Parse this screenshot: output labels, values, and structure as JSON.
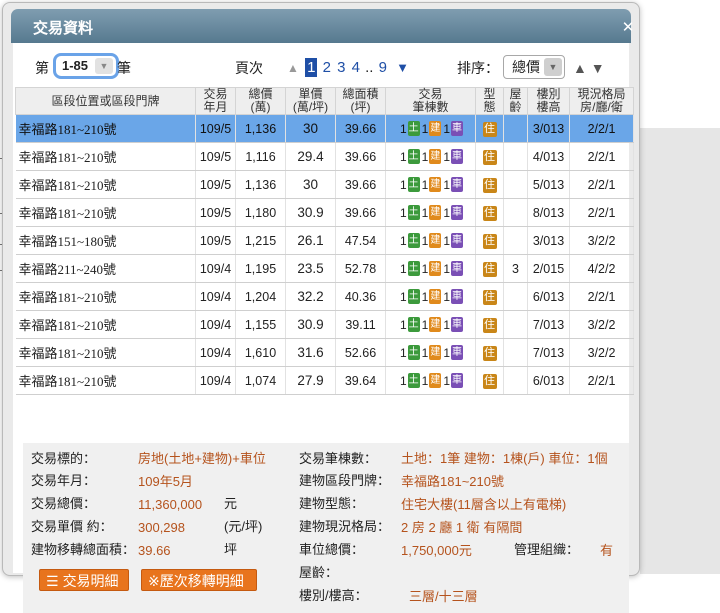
{
  "title": "交易資料",
  "controls": {
    "prefix": "第",
    "range": "1-85",
    "suffix": "筆",
    "page_label": "頁次",
    "pages": [
      "1",
      "2",
      "3",
      "4"
    ],
    "ellipsis": "..",
    "last_page": "9",
    "sort_label": "排序：",
    "sort_value": "總價"
  },
  "columns": [
    "區段位置或區段門牌",
    "交易\n年月",
    "總價\n(萬)",
    "單價\n(萬/坪)",
    "總面積\n(坪)",
    "交易\n筆棟數",
    "型\n態",
    "屋\n齡",
    "樓別\n樓高",
    "現況格局\n房/廳/衛"
  ],
  "rows": [
    {
      "addr": "幸福路181~210號",
      "ym": "109/5",
      "total": "1,136",
      "unit": "30",
      "area": "39.66",
      "land": "1",
      "bldg": "1",
      "car": "1",
      "type": "住",
      "age": "",
      "floor": "3/013",
      "layout": "2/2/1"
    },
    {
      "addr": "幸福路181~210號",
      "ym": "109/5",
      "total": "1,116",
      "unit": "29.4",
      "area": "39.66",
      "land": "1",
      "bldg": "1",
      "car": "1",
      "type": "住",
      "age": "",
      "floor": "4/013",
      "layout": "2/2/1"
    },
    {
      "addr": "幸福路181~210號",
      "ym": "109/5",
      "total": "1,136",
      "unit": "30",
      "area": "39.66",
      "land": "1",
      "bldg": "1",
      "car": "1",
      "type": "住",
      "age": "",
      "floor": "5/013",
      "layout": "2/2/1"
    },
    {
      "addr": "幸福路181~210號",
      "ym": "109/5",
      "total": "1,180",
      "unit": "30.9",
      "area": "39.66",
      "land": "1",
      "bldg": "1",
      "car": "1",
      "type": "住",
      "age": "",
      "floor": "8/013",
      "layout": "2/2/1"
    },
    {
      "addr": "幸福路151~180號",
      "ym": "109/5",
      "total": "1,215",
      "unit": "26.1",
      "area": "47.54",
      "land": "1",
      "bldg": "1",
      "car": "1",
      "type": "住",
      "age": "",
      "floor": "3/013",
      "layout": "3/2/2"
    },
    {
      "addr": "幸福路211~240號",
      "ym": "109/4",
      "total": "1,195",
      "unit": "23.5",
      "area": "52.78",
      "land": "1",
      "bldg": "1",
      "car": "1",
      "type": "住",
      "age": "3",
      "floor": "2/015",
      "layout": "4/2/2"
    },
    {
      "addr": "幸福路181~210號",
      "ym": "109/4",
      "total": "1,204",
      "unit": "32.2",
      "area": "40.36",
      "land": "1",
      "bldg": "1",
      "car": "1",
      "type": "住",
      "age": "",
      "floor": "6/013",
      "layout": "2/2/1"
    },
    {
      "addr": "幸福路181~210號",
      "ym": "109/4",
      "total": "1,155",
      "unit": "30.9",
      "area": "39.11",
      "land": "1",
      "bldg": "1",
      "car": "1",
      "type": "住",
      "age": "",
      "floor": "7/013",
      "layout": "3/2/2"
    },
    {
      "addr": "幸福路181~210號",
      "ym": "109/4",
      "total": "1,610",
      "unit": "31.6",
      "area": "52.66",
      "land": "1",
      "bldg": "1",
      "car": "1",
      "type": "住",
      "age": "",
      "floor": "7/013",
      "layout": "3/2/2"
    },
    {
      "addr": "幸福路181~210號",
      "ym": "109/4",
      "total": "1,074",
      "unit": "27.9",
      "area": "39.64",
      "land": "1",
      "bldg": "1",
      "car": "1",
      "type": "住",
      "age": "",
      "floor": "6/013",
      "layout": "2/2/1"
    }
  ],
  "badges": {
    "land": "土",
    "bldg": "建",
    "car": "車"
  },
  "details": {
    "target_label": "交易標的：",
    "target_value": "房地(土地+建物)+車位",
    "ym_label": "交易年月：",
    "ym_value": "109年5月",
    "total_label": "交易總價：",
    "total_value": "11,360,000",
    "total_unit": "元",
    "unit_label": "交易單價 約：",
    "unit_value": "300,298",
    "unit_unit": "(元/坪)",
    "area_label": "建物移轉總面積：",
    "area_value": "39.66",
    "area_unit": "坪",
    "count_label": "交易筆棟數：",
    "count_value": "土地：1筆 建物：1棟(戶) 車位：1個",
    "addr_label": "建物區段門牌：",
    "addr_value": "幸福路181~210號",
    "btype_label": "建物型態：",
    "btype_value": "住宅大樓(11層含以上有電梯)",
    "layout_label": "建物現況格局：",
    "layout_value": "2 房 2 廳 1 衛 有隔間",
    "parking_label": "車位總價：",
    "parking_value": "1,750,000元",
    "mgmt_label": "管理組織：",
    "mgmt_value": "有",
    "age_label": "屋齡：",
    "floor_label": "樓別/樓高：",
    "floor_value": "三層/十三層"
  },
  "buttons": {
    "detail": "交易明細",
    "history": "※歷次移轉明細"
  }
}
